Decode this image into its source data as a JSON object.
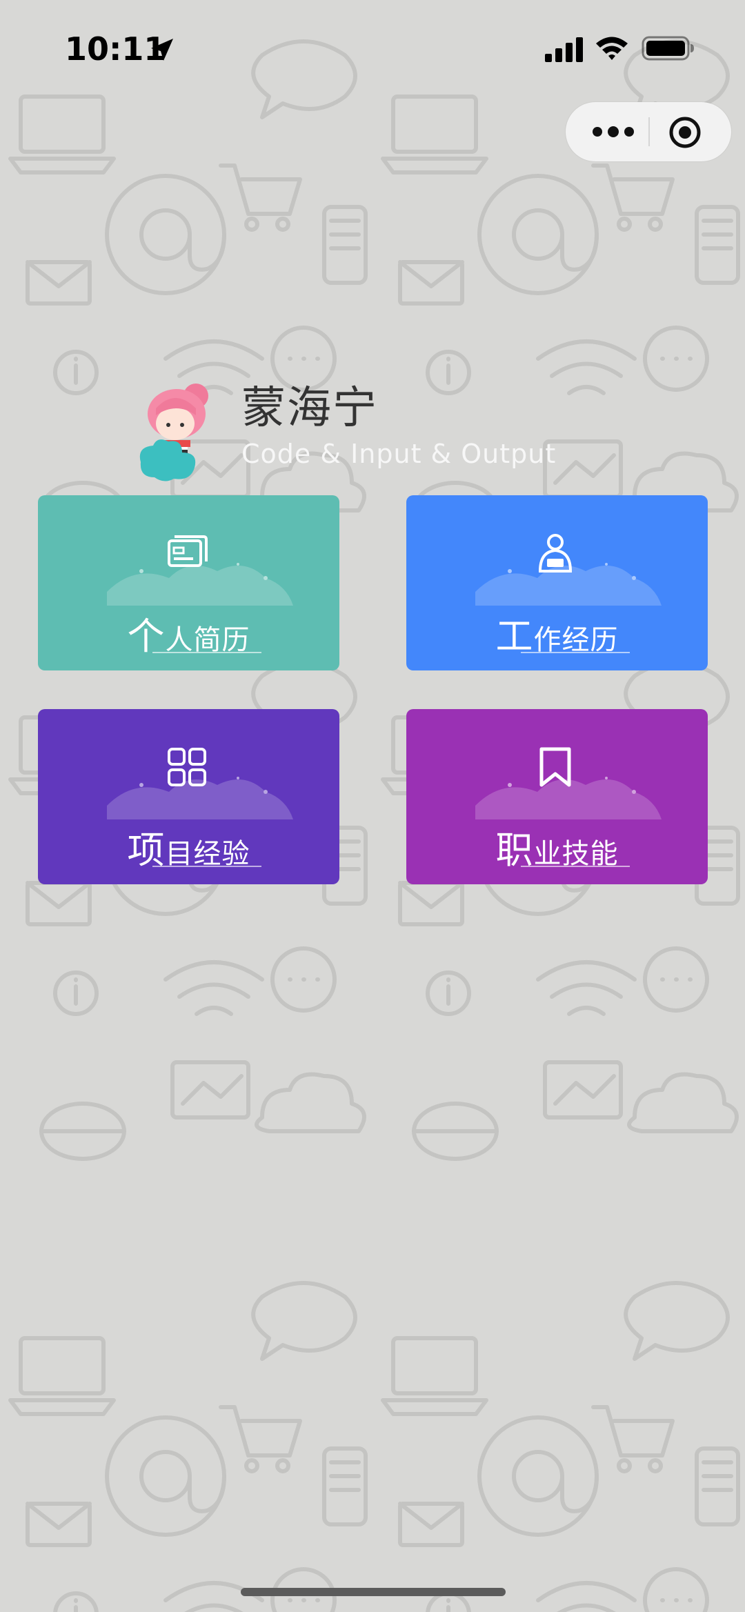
{
  "status_bar": {
    "time": "10:11",
    "icons": [
      "location-arrow-icon",
      "cellular-signal-icon",
      "wifi-icon",
      "battery-icon"
    ]
  },
  "capsule": {
    "icons": [
      "more-icon",
      "close-icon"
    ]
  },
  "profile": {
    "name": "蒙海宁",
    "subtitle": "Code & Input & Output",
    "avatar_icon": "girl-avatar-icon"
  },
  "menu": {
    "cards": [
      {
        "label_first": "个",
        "label_rest": "人简历",
        "icon": "id-card-icon",
        "color": "#5ebdb2"
      },
      {
        "label_first": "工",
        "label_rest": "作经历",
        "icon": "person-laptop-icon",
        "color": "#4387fb"
      },
      {
        "label_first": "项",
        "label_rest": "目经验",
        "icon": "grid-apps-icon",
        "color": "#6138bd"
      },
      {
        "label_first": "职",
        "label_rest": "业技能",
        "icon": "bookmark-icon",
        "color": "#9a31b4"
      }
    ]
  },
  "colors": {
    "background": "#d8d8d6",
    "pattern_stroke": "#c4c4c2",
    "name_text": "#333333",
    "subtitle_text": "#f7f7f7"
  }
}
